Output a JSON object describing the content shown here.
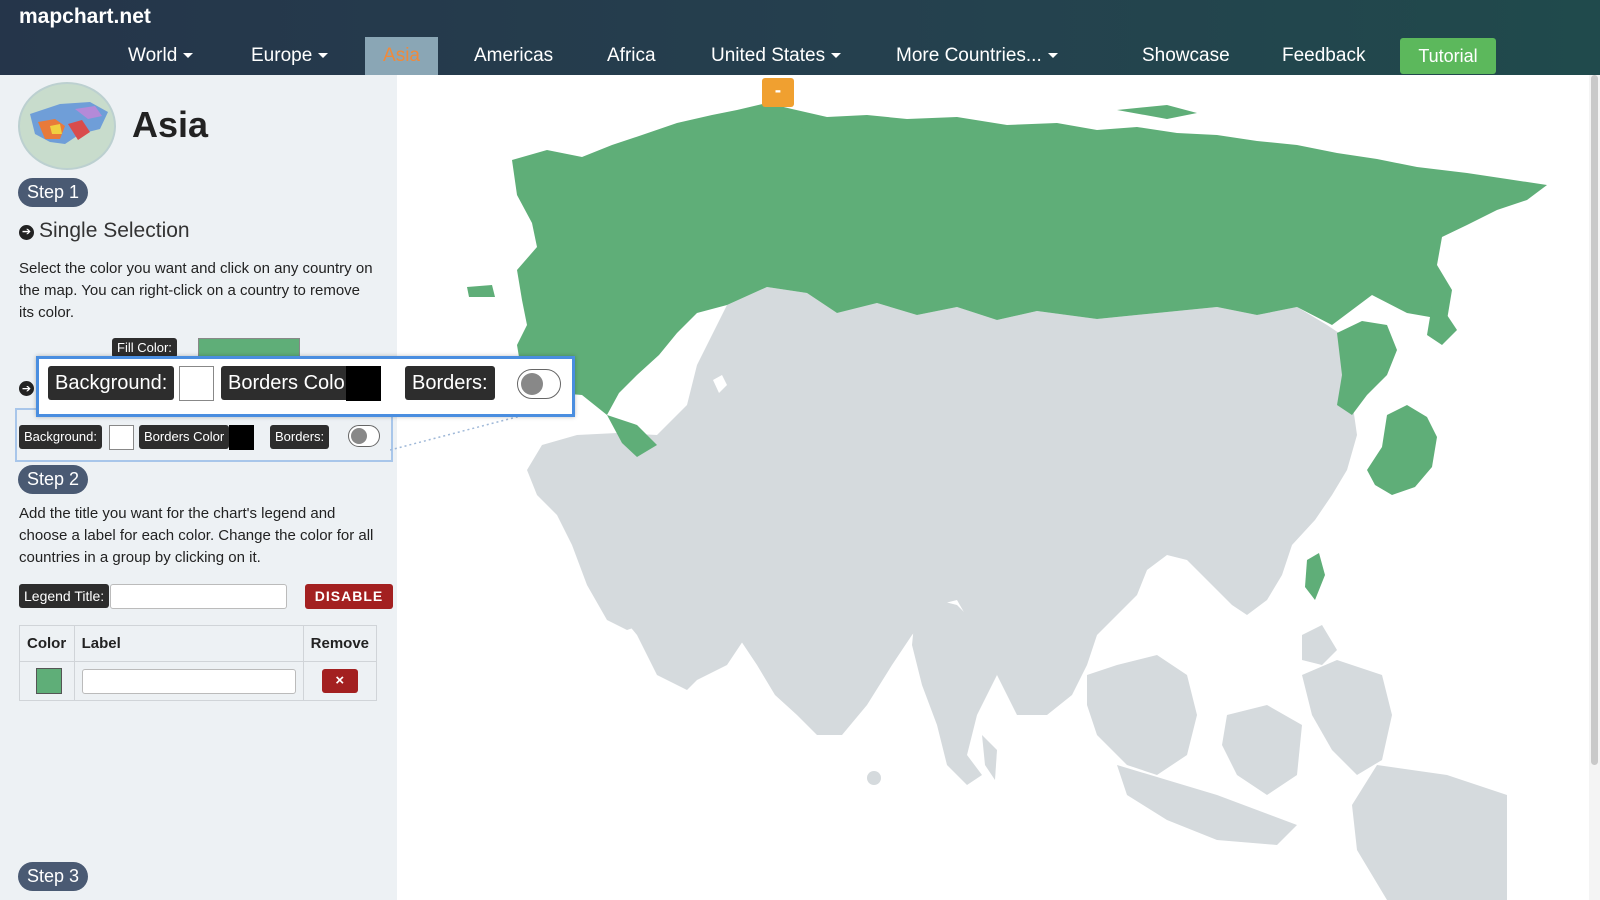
{
  "header": {
    "brand": "mapchart.net",
    "nav": [
      {
        "label": "World",
        "dropdown": true
      },
      {
        "label": "Europe",
        "dropdown": true
      },
      {
        "label": "Asia",
        "dropdown": false,
        "active": true
      },
      {
        "label": "Americas",
        "dropdown": false
      },
      {
        "label": "Africa",
        "dropdown": false
      },
      {
        "label": "United States",
        "dropdown": true
      },
      {
        "label": "More Countries...",
        "dropdown": true
      },
      {
        "label": "Showcase",
        "dropdown": false
      },
      {
        "label": "Feedback",
        "dropdown": false
      }
    ],
    "tutorial_label": "Tutorial"
  },
  "map": {
    "zoom_out_label": "-",
    "selected_color": "#5fae78",
    "unselected_color": "#d5dadd"
  },
  "sidebar": {
    "region_title": "Asia",
    "step1": {
      "pill": "Step 1",
      "subhead": "Single Selection",
      "description": "Select the color you want and click on any country on the map. You can right-click on a country to remove its color.",
      "fill_color_label": "Fill Color:",
      "fill_color": "#5fae78"
    },
    "style_row": {
      "background_label": "Background:",
      "background_color": "#ffffff",
      "borders_color_label": "Borders Color",
      "borders_color": "#000000",
      "borders_label": "Borders:"
    },
    "step2": {
      "pill": "Step 2",
      "description": "Add the title you want for the chart's legend and choose a label for each color. Change the color for all countries in a group by clicking on it.",
      "legend_title_label": "Legend Title:",
      "legend_title_value": "",
      "disable_label": "DISABLE",
      "table": {
        "headers": [
          "Color",
          "Label",
          "Remove"
        ],
        "rows": [
          {
            "color": "#5fae78",
            "label": ""
          }
        ]
      },
      "remove_icon": "×"
    },
    "step3": {
      "pill": "Step 3"
    }
  }
}
